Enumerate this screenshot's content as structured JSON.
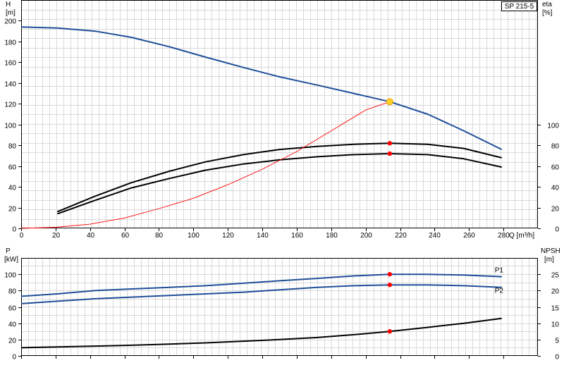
{
  "chart_data": [
    {
      "type": "line",
      "title": "",
      "model_label": "SP 215-5",
      "xlabel": "Q [m³/h]",
      "ylabel_left": {
        "name": "H",
        "unit": "[m]"
      },
      "ylabel_right": {
        "name": "eta",
        "unit": "[%]"
      },
      "xlim": [
        0,
        300
      ],
      "ylim_left": [
        0,
        220
      ],
      "ylim_right": [
        0,
        220
      ],
      "x_ticks": [
        0,
        20,
        40,
        60,
        80,
        100,
        120,
        140,
        160,
        180,
        200,
        220,
        240,
        260,
        280
      ],
      "y_ticks_left": [
        0,
        20,
        40,
        60,
        80,
        100,
        120,
        140,
        160,
        180,
        200
      ],
      "y_ticks_right": [
        0,
        20,
        40,
        60,
        80,
        100
      ],
      "grid": true,
      "series": [
        {
          "color": "#1f4e99",
          "x": [
            0,
            21,
            43,
            64,
            86,
            107,
            129,
            150,
            172,
            193,
            214,
            236,
            257,
            279
          ],
          "y": [
            194,
            193,
            190,
            184,
            175,
            165,
            155,
            146,
            138,
            130,
            122,
            110,
            94,
            76
          ]
        },
        {
          "color": "#000000",
          "x": [
            21,
            43,
            64,
            86,
            107,
            129,
            150,
            172,
            193,
            214,
            236,
            257,
            279
          ],
          "y": [
            16,
            31,
            44,
            55,
            64,
            71,
            76,
            79,
            81,
            82,
            81,
            77,
            68
          ]
        },
        {
          "color": "#000000",
          "x": [
            21,
            43,
            64,
            86,
            107,
            129,
            150,
            172,
            193,
            214,
            236,
            257,
            279
          ],
          "y": [
            14,
            27,
            39,
            48,
            56,
            62,
            66,
            69,
            71,
            72,
            71,
            67,
            59
          ]
        },
        {
          "color": "#ff0000",
          "x": [
            0,
            20,
            40,
            60,
            80,
            100,
            120,
            140,
            160,
            180,
            200,
            214
          ],
          "y": [
            0,
            1,
            4,
            10,
            19,
            29,
            42,
            57,
            74,
            94,
            114,
            122
          ]
        }
      ],
      "duty_point": {
        "x": 214,
        "y": 122,
        "color": "#ffd02a"
      },
      "markers": [
        {
          "x": 214,
          "y": 82,
          "color": "#ff0000"
        },
        {
          "x": 214,
          "y": 72,
          "color": "#ff0000"
        }
      ]
    },
    {
      "type": "line",
      "title": "",
      "xlabel": "",
      "ylabel_left": {
        "name": "P",
        "unit": "[kW]"
      },
      "ylabel_right": {
        "name": "NPSH",
        "unit": "[m]"
      },
      "xlim": [
        0,
        300
      ],
      "ylim_left": [
        0,
        120
      ],
      "ylim_right": [
        0,
        30
      ],
      "x_ticks": [
        0,
        20,
        40,
        60,
        80,
        100,
        120,
        140,
        160,
        180,
        200,
        220,
        240,
        260,
        280
      ],
      "y_ticks_left": [
        0,
        20,
        40,
        60,
        80,
        100
      ],
      "y_ticks_right": [
        0,
        5,
        10,
        15,
        20,
        25
      ],
      "grid": true,
      "series": [
        {
          "name": "P1",
          "color": "#1f4e99",
          "x": [
            0,
            21,
            43,
            64,
            86,
            107,
            129,
            150,
            172,
            193,
            214,
            236,
            257,
            279
          ],
          "y": [
            73,
            76,
            80,
            82,
            84,
            86,
            89,
            92,
            95,
            98,
            100,
            100,
            99,
            97
          ]
        },
        {
          "name": "P2",
          "color": "#1f4e99",
          "x": [
            0,
            21,
            43,
            64,
            86,
            107,
            129,
            150,
            172,
            193,
            214,
            236,
            257,
            279
          ],
          "y": [
            64,
            67,
            70,
            72,
            74,
            76,
            78,
            81,
            84,
            86,
            87,
            87,
            86,
            84
          ]
        },
        {
          "color": "#000000",
          "x": [
            0,
            21,
            43,
            64,
            86,
            107,
            129,
            150,
            172,
            193,
            214,
            236,
            257,
            279
          ],
          "y": [
            10,
            11,
            12,
            13,
            14.5,
            16,
            18,
            20,
            22.5,
            26,
            30,
            35,
            40,
            46
          ]
        }
      ],
      "markers": [
        {
          "x": 214,
          "y": 100,
          "color": "#ff0000"
        },
        {
          "x": 214,
          "y": 87,
          "color": "#ff0000"
        },
        {
          "x": 214,
          "y": 30,
          "color": "#ff0000"
        }
      ]
    }
  ]
}
